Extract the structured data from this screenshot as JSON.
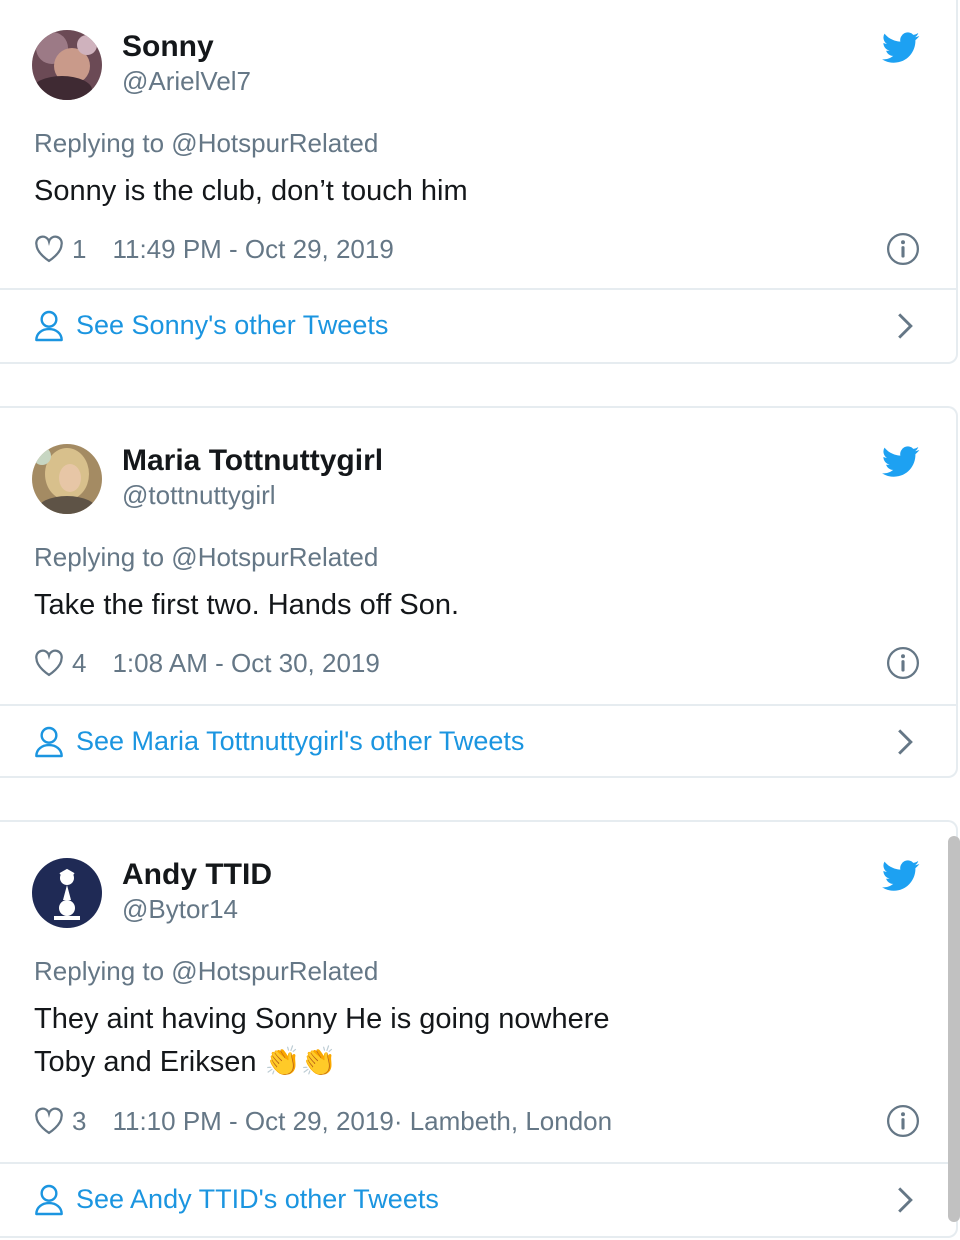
{
  "tweets": [
    {
      "display_name": "Sonny",
      "handle": "@ArielVel7",
      "replying_to": "Replying to @HotspurRelated",
      "text": "Sonny is the club, don’t touch him",
      "likes": "1",
      "timestamp": "11:49 PM - Oct 29, 2019",
      "location": "",
      "other_tweets_label": "See Sonny's other Tweets",
      "avatar_icon": "avatar-photo-icon"
    },
    {
      "display_name": "Maria Tottnuttygirl",
      "handle": "@tottnuttygirl",
      "replying_to": "Replying to @HotspurRelated",
      "text": "Take the first two. Hands off Son.",
      "likes": "4",
      "timestamp": "1:08 AM - Oct 30, 2019",
      "location": "",
      "other_tweets_label": "See Maria Tottnuttygirl's other Tweets",
      "avatar_icon": "avatar-photo-icon"
    },
    {
      "display_name": "Andy TTID",
      "handle": "@Bytor14",
      "replying_to": "Replying to @HotspurRelated",
      "text_line1": "They aint having Sonny He is going nowhere",
      "text_line2": "Toby and Eriksen 👏👏",
      "likes": "3",
      "timestamp": "11:10 PM - Oct 29, 2019",
      "location": " · Lambeth, London",
      "other_tweets_label": "See Andy TTID's other Tweets",
      "avatar_icon": "spurs-cockerel-icon"
    }
  ],
  "colors": {
    "link_blue": "#1b95e0",
    "twitter_blue": "#1da1f2",
    "secondary_text": "#657786",
    "primary_text": "#14171a",
    "border": "#e6ecf0"
  }
}
